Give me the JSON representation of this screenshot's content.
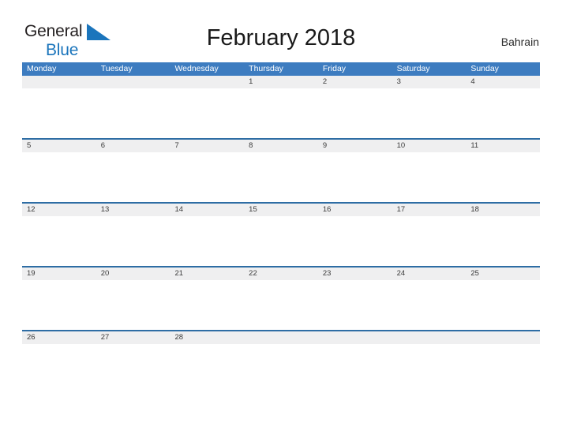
{
  "brand": {
    "name_part1": "General",
    "name_part2": "Blue",
    "flag_icon": "blue-triangle-flag-icon",
    "color_primary": "#1b75bc",
    "color_text": "#231f20"
  },
  "header": {
    "title": "February 2018",
    "country": "Bahrain"
  },
  "calendar": {
    "month": "February",
    "year": "2018",
    "header_color": "#3d7cc0",
    "row_border_color": "#2e6da4",
    "date_strip_color": "#efeff0",
    "weekdays": [
      "Monday",
      "Tuesday",
      "Wednesday",
      "Thursday",
      "Friday",
      "Saturday",
      "Sunday"
    ],
    "weeks": [
      [
        "",
        "",
        "",
        "1",
        "2",
        "3",
        "4"
      ],
      [
        "5",
        "6",
        "7",
        "8",
        "9",
        "10",
        "11"
      ],
      [
        "12",
        "13",
        "14",
        "15",
        "16",
        "17",
        "18"
      ],
      [
        "19",
        "20",
        "21",
        "22",
        "23",
        "24",
        "25"
      ],
      [
        "26",
        "27",
        "28",
        "",
        "",
        "",
        ""
      ]
    ]
  }
}
